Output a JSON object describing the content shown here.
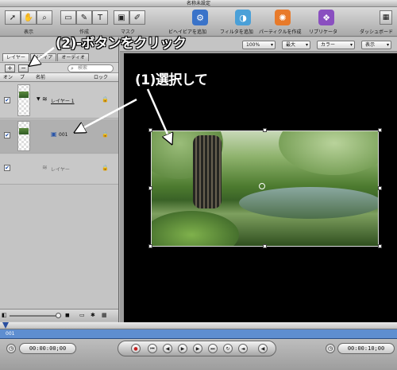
{
  "window": {
    "title": "名称未設定"
  },
  "toolbar": {
    "left_labels": [
      "表示",
      "作成",
      "マスク"
    ],
    "right_items": [
      {
        "label": "ビヘイビアを追加",
        "icon": "behavior-gear-icon",
        "color": "#3a73c9"
      },
      {
        "label": "フィルタを追加",
        "icon": "filter-icon",
        "color": "#4aa0d8"
      },
      {
        "label": "パーティクルを作成",
        "icon": "particle-icon",
        "color": "#e87a2a"
      },
      {
        "label": "リプリケータ",
        "icon": "replicator-icon",
        "color": "#8a4fc0"
      }
    ],
    "dashboard_label": "ダッシュボード"
  },
  "left_panel": {
    "tabs": [
      "レイヤー",
      "メディア",
      "オーディオ"
    ],
    "search_placeholder": "検索",
    "columns": {
      "on": "オン",
      "preview": "プ",
      "name": "名前",
      "lock": "ロック"
    },
    "rows": [
      {
        "name": "レイヤー 1",
        "type": "group",
        "checked": "✔"
      },
      {
        "name": "001",
        "type": "image",
        "checked": "✔"
      },
      {
        "name": "レイヤー",
        "type": "placeholder",
        "checked": "✔"
      }
    ]
  },
  "canvas_bar": {
    "zoom": "100%",
    "resolution": "最大",
    "color": "カラー",
    "view": "表示"
  },
  "timeline": {
    "track_name": "001",
    "current_timecode": "00:00:00;00",
    "duration_timecode": "00:00:10;00"
  },
  "annotations": {
    "step2": "(2)-ボタンをクリック",
    "step1": "(1)選択して"
  }
}
